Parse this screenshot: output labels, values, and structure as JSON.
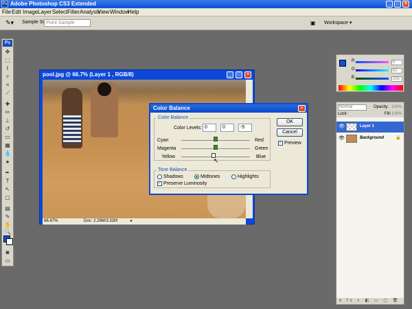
{
  "app": {
    "title": "Adobe Photoshop CS3 Extended",
    "menu": [
      "File",
      "Edit",
      "Image",
      "Layer",
      "Select",
      "Filter",
      "Analysis",
      "View",
      "Window",
      "Help"
    ]
  },
  "options_bar": {
    "sample_size_label": "Sample Size:",
    "sample_size_value": "Point Sample",
    "workspace_label": "Workspace"
  },
  "toolbox": {
    "logo": "Ps",
    "foreground_color": "#0b52e0",
    "background_color": "#ffffff"
  },
  "document": {
    "title": "pool.jpg @ 66.7% (Layer 1 , RGB/8)",
    "zoom": "66.67%",
    "doc_size": "Doc: 2.29M/3.32M"
  },
  "color_balance_dialog": {
    "title": "Color Balance",
    "color_balance_group": "Color Balance",
    "color_levels_label": "Color Levels:",
    "levels": [
      "0",
      "0",
      "-5"
    ],
    "sliders": [
      {
        "left": "Cyan",
        "right": "Red",
        "value": 0
      },
      {
        "left": "Magenta",
        "right": "Green",
        "value": 0
      },
      {
        "left": "Yellow",
        "right": "Blue",
        "value": -5
      }
    ],
    "tone_balance_group": "Tone Balance",
    "tones": [
      "Shadows",
      "Midtones",
      "Highlights"
    ],
    "selected_tone": "Midtones",
    "preserve_luminosity": "Preserve Luminosity",
    "ok": "OK",
    "cancel": "Cancel",
    "preview": "Preview"
  },
  "color_panel": {
    "channels": [
      "R",
      "G",
      "B"
    ],
    "values": [
      "0",
      "82",
      "255"
    ]
  },
  "layers_panel": {
    "blend_mode": "Normal",
    "opacity_label": "Opacity:",
    "opacity_value": "100%",
    "lock_label": "Lock:",
    "fill_label": "Fill:",
    "fill_value": "100%",
    "layers": [
      {
        "name": "Layer 1",
        "selected": true
      },
      {
        "name": "Background",
        "selected": false
      }
    ],
    "footer_icons": "ɑ fx ◐ ◧ ▭ ▢ 🗑"
  }
}
